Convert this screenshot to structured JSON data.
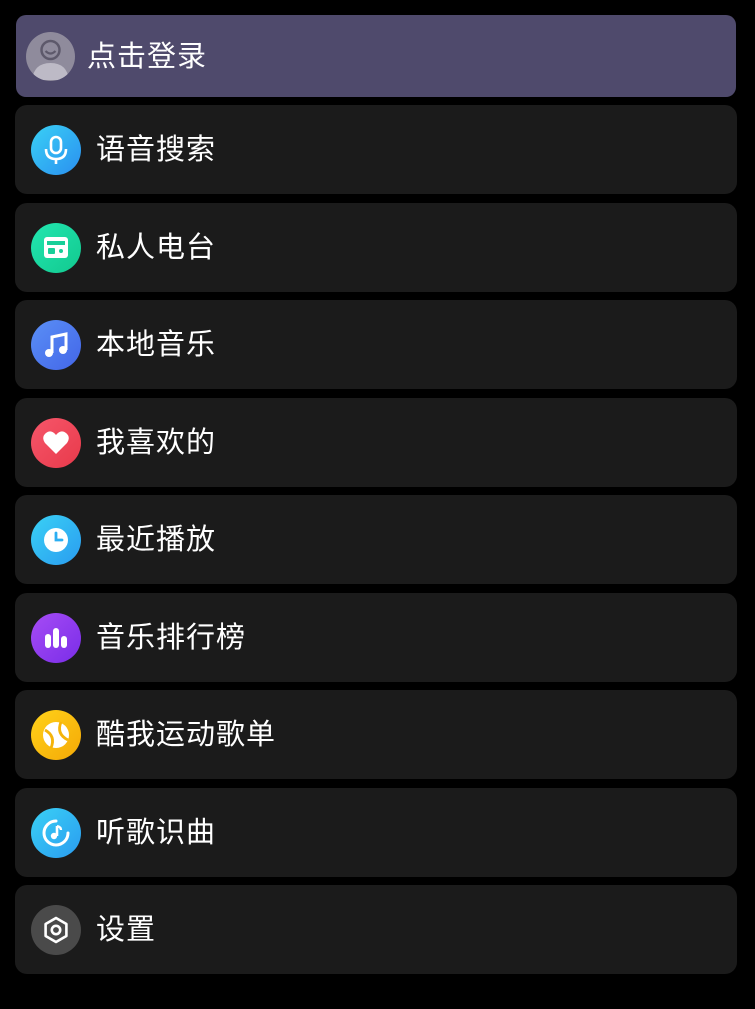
{
  "login": {
    "label": "点击登录"
  },
  "items": [
    {
      "label": "语音搜索",
      "icon": "microphone-icon",
      "color": "#2fb8f3"
    },
    {
      "label": "私人电台",
      "icon": "radio-icon",
      "color": "#1ad9a3"
    },
    {
      "label": "本地音乐",
      "icon": "music-note-icon",
      "color": "#4b7cf2"
    },
    {
      "label": "我喜欢的",
      "icon": "heart-icon",
      "color": "#f24a5a"
    },
    {
      "label": "最近播放",
      "icon": "clock-icon",
      "color": "#2fb8f3"
    },
    {
      "label": "音乐排行榜",
      "icon": "bar-chart-icon",
      "color": "#8a3cf0"
    },
    {
      "label": "酷我运动歌单",
      "icon": "ball-icon",
      "color": "#f7b90a"
    },
    {
      "label": "听歌识曲",
      "icon": "music-recognition-icon",
      "color": "#2fb8f3"
    },
    {
      "label": "设置",
      "icon": "settings-hexagon-icon",
      "color": "#4a4a4a"
    }
  ]
}
